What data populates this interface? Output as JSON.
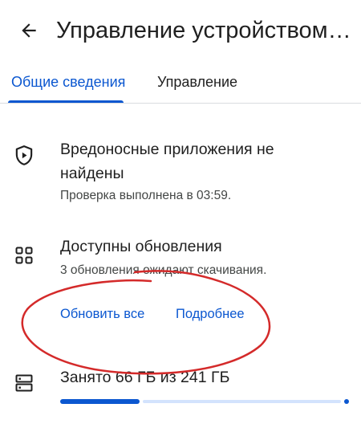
{
  "appbar": {
    "title": "Управление устройством и..."
  },
  "tabs": [
    {
      "label": "Общие сведения",
      "selected": true
    },
    {
      "label": "Управление",
      "selected": false
    }
  ],
  "security": {
    "icon": "shield-play-icon",
    "title": "Вредоносные приложения не найдены",
    "subtitle": "Проверка выполнена в 03:59."
  },
  "updates": {
    "icon": "apps-grid-icon",
    "title": "Доступны обновления",
    "subtitle": "3 обновления ожидают скачивания.",
    "update_all_label": "Обновить все",
    "details_label": "Подробнее"
  },
  "storage": {
    "icon": "storage-icon",
    "title": "Занято 66 ГБ из 241 ГБ",
    "used_gb": 66,
    "total_gb": 241
  },
  "annotation": {
    "color": "#d42a2a"
  },
  "colors": {
    "accent": "#0b57d0",
    "text": "#1f1f1f",
    "secondary_text": "#444746",
    "bar_track": "#d3e3fd"
  }
}
